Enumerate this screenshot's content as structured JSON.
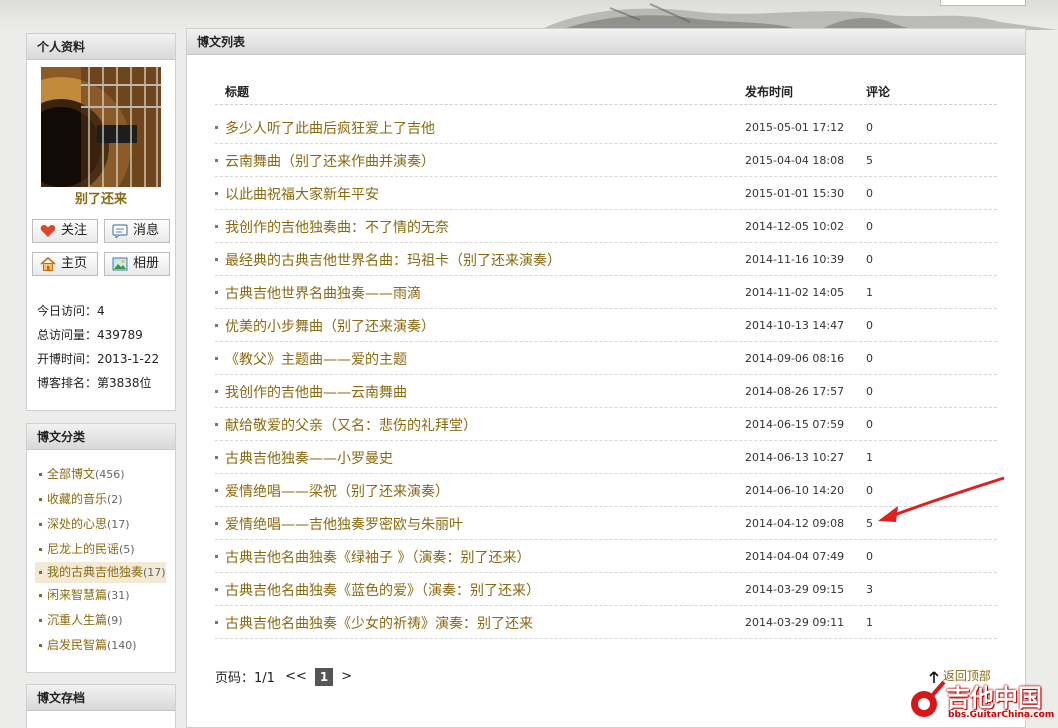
{
  "profile": {
    "heading": "个人资料",
    "nickname": "别了还来",
    "buttons": {
      "follow": "关注",
      "message": "消息",
      "home": "主页",
      "album": "相册"
    },
    "stats": [
      "今日访问：4",
      "总访问量：439789",
      "开博时间：2013-1-22",
      "博客排名：第3838位"
    ]
  },
  "category": {
    "heading": "博文分类",
    "items": [
      {
        "label": "全部博文",
        "count": "(456)"
      },
      {
        "label": "收藏的音乐",
        "count": "(2)"
      },
      {
        "label": "深处的心思",
        "count": "(17)"
      },
      {
        "label": "尼龙上的民谣",
        "count": "(5)"
      },
      {
        "label": "我的古典吉他独奏",
        "count": "(17)"
      },
      {
        "label": "闲来智慧篇",
        "count": "(31)"
      },
      {
        "label": "沉重人生篇",
        "count": "(9)"
      },
      {
        "label": "启发民智篇",
        "count": "(140)"
      }
    ]
  },
  "archive": {
    "heading": "博文存档"
  },
  "main": {
    "heading": "博文列表",
    "columns": {
      "title": "标题",
      "time": "发布时间",
      "comments": "评论"
    },
    "rows": [
      {
        "title": "多少人听了此曲后疯狂爱上了吉他",
        "time": "2015-05-01 17:12",
        "comments": "0"
      },
      {
        "title": "云南舞曲（别了还来作曲并演奏）",
        "time": "2015-04-04 18:08",
        "comments": "5"
      },
      {
        "title": "以此曲祝福大家新年平安",
        "time": "2015-01-01 15:30",
        "comments": "0"
      },
      {
        "title": "我创作的吉他独奏曲：不了情的无奈",
        "time": "2014-12-05 10:02",
        "comments": "0"
      },
      {
        "title": "最经典的古典吉他世界名曲：玛祖卡（别了还来演奏）",
        "time": "2014-11-16 10:39",
        "comments": "0"
      },
      {
        "title": "古典吉他世界名曲独奏——雨滴",
        "time": "2014-11-02 14:05",
        "comments": "1"
      },
      {
        "title": "优美的小步舞曲（别了还来演奏）",
        "time": "2014-10-13 14:47",
        "comments": "0"
      },
      {
        "title": "《教父》主题曲——爱的主题",
        "time": "2014-09-06 08:16",
        "comments": "0"
      },
      {
        "title": "我创作的吉他曲——云南舞曲",
        "time": "2014-08-26 17:57",
        "comments": "0"
      },
      {
        "title": "献给敬爱的父亲（又名：悲伤的礼拜堂）",
        "time": "2014-06-15 07:59",
        "comments": "0"
      },
      {
        "title": "古典吉他独奏——小罗曼史",
        "time": "2014-06-13 10:27",
        "comments": "1"
      },
      {
        "title": "爱情绝唱——梁祝（别了还来演奏）",
        "time": "2014-06-10 14:20",
        "comments": "0"
      },
      {
        "title": "爱情绝唱——吉他独奏罗密欧与朱丽叶",
        "time": "2014-04-12 09:08",
        "comments": "5"
      },
      {
        "title": "古典吉他名曲独奏《绿袖子 》（演奏：别了还来）",
        "time": "2014-04-04 07:49",
        "comments": "0"
      },
      {
        "title": "古典吉他名曲独奏《蓝色的爱》（演奏：别了还来）",
        "time": "2014-03-29 09:15",
        "comments": "3"
      },
      {
        "title": "古典吉他名曲独奏《少女的祈祷》演奏：别了还来",
        "time": "2014-03-29 09:11",
        "comments": "1"
      }
    ],
    "pager": {
      "label": "页码：1/1",
      "prev": "<<",
      "current": "1",
      "next": ">"
    },
    "back_top": "返回顶部"
  },
  "watermark": {
    "text": "吉他中国",
    "url": "bbs.GuitarChina.com"
  },
  "colors": {
    "link": "#8a6a10",
    "arrow": "#e02020"
  },
  "icons": [
    "heart-icon",
    "message-icon",
    "home-icon",
    "album-icon",
    "up-arrow-icon"
  ]
}
